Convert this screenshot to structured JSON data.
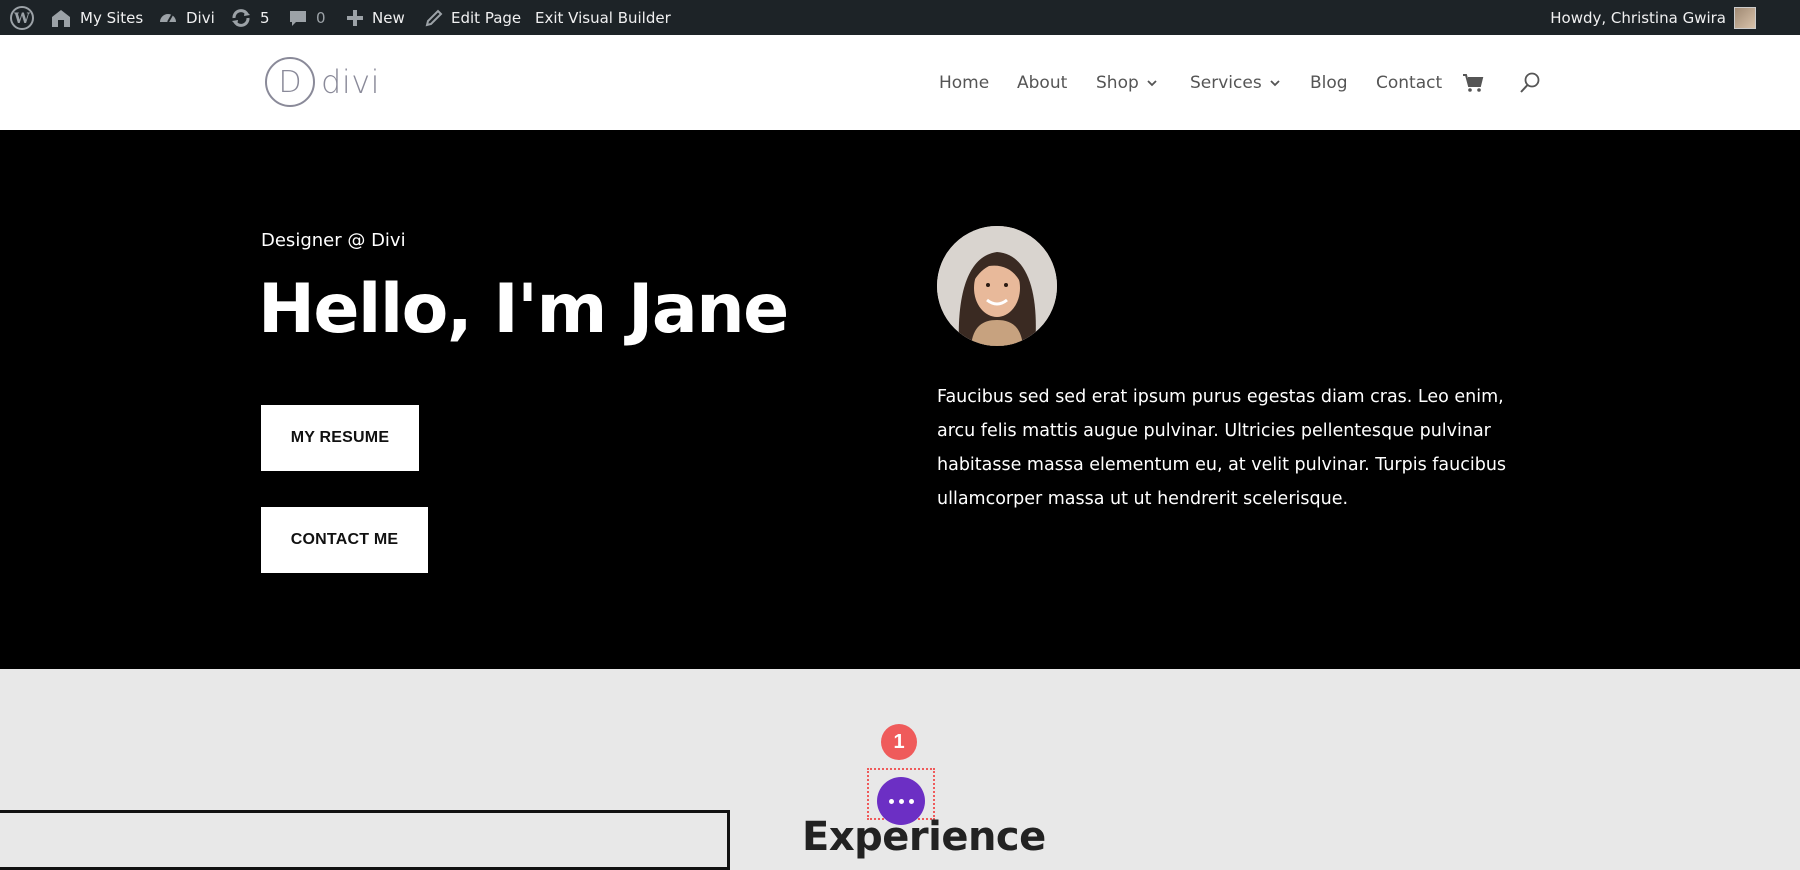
{
  "admin_bar": {
    "my_sites": "My Sites",
    "site_name": "Divi",
    "updates_count": "5",
    "comments_count": "0",
    "new_label": "New",
    "edit_page": "Edit Page",
    "exit_builder": "Exit Visual Builder",
    "greeting": "Howdy, Christina Gwira"
  },
  "header": {
    "logo_letter": "D",
    "logo_text": "divi",
    "nav": [
      {
        "label": "Home"
      },
      {
        "label": "About"
      },
      {
        "label": "Shop"
      },
      {
        "label": "Services"
      },
      {
        "label": "Blog"
      },
      {
        "label": "Contact"
      }
    ]
  },
  "hero": {
    "eyebrow": "Designer @ Divi",
    "title": "Hello, I'm Jane",
    "resume_button": "MY RESUME",
    "contact_button": "CONTACT ME",
    "bio": "Faucibus sed sed erat ipsum purus egestas diam cras. Leo enim, arcu felis mattis augue pulvinar. Ultricies pellentesque pulvinar habitasse massa elementum eu, at velit pulvinar. Turpis faucibus ullamcorper massa ut ut hendrerit scelerisque."
  },
  "lower": {
    "step_number": "1",
    "section_title": "Experience"
  },
  "colors": {
    "admin_bar_bg": "#1d2327",
    "hero_bg": "#000000",
    "builder_purple": "#6c2fc4",
    "annotation_red": "#ef5b5b",
    "section_bg": "#e8e8e8"
  }
}
